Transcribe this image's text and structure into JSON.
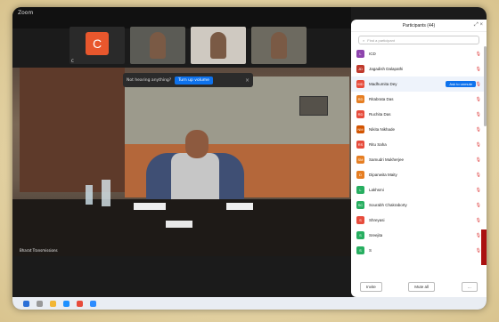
{
  "window": {
    "title": "Zoom"
  },
  "thumbnails": [
    {
      "initial": "C",
      "name": "C"
    },
    {
      "name": ""
    },
    {
      "name": ""
    },
    {
      "name": ""
    }
  ],
  "banner": {
    "question": "Not hearing anything?",
    "button": "Turn up volume"
  },
  "video": {
    "nameplate": "",
    "speaker_name": "Bharat Transmissions"
  },
  "panel": {
    "title": "Participants (44)",
    "search_placeholder": "Find a participant",
    "admit_label": "Ask to unmute",
    "participants": [
      {
        "initial": "L",
        "name": "ICD",
        "color": "#8e44ad"
      },
      {
        "initial": "JD",
        "name": "Jagadish Dalapathi",
        "color": "#c0392b"
      },
      {
        "initial": "MD",
        "name": "Madhumita Dey",
        "color": "#e74c3c",
        "highlight": true
      },
      {
        "initial": "RD",
        "name": "Ritabrata Das",
        "color": "#e67e22"
      },
      {
        "initial": "RD",
        "name": "Ruchita Das",
        "color": "#e74c3c"
      },
      {
        "initial": "NM",
        "name": "Nikita Nikhade",
        "color": "#d35400"
      },
      {
        "initial": "RS",
        "name": "Ritu Saha",
        "color": "#e74c3c"
      },
      {
        "initial": "SM",
        "name": "Samudri Mukherjee",
        "color": "#e67e22"
      },
      {
        "initial": "D",
        "name": "Dipanwita Maity",
        "color": "#e67e22"
      },
      {
        "initial": "L",
        "name": "Lakhsmi",
        "color": "#27ae60"
      },
      {
        "initial": "SC",
        "name": "Sourabh Chakraborty",
        "color": "#27ae60"
      },
      {
        "initial": "S",
        "name": "Shreyasi",
        "color": "#e74c3c"
      },
      {
        "initial": "S",
        "name": "Sreejita",
        "color": "#27ae60"
      },
      {
        "initial": "S",
        "name": "S",
        "color": "#27ae60"
      }
    ],
    "invite_label": "Invite",
    "mute_all_label": "Mute all"
  }
}
